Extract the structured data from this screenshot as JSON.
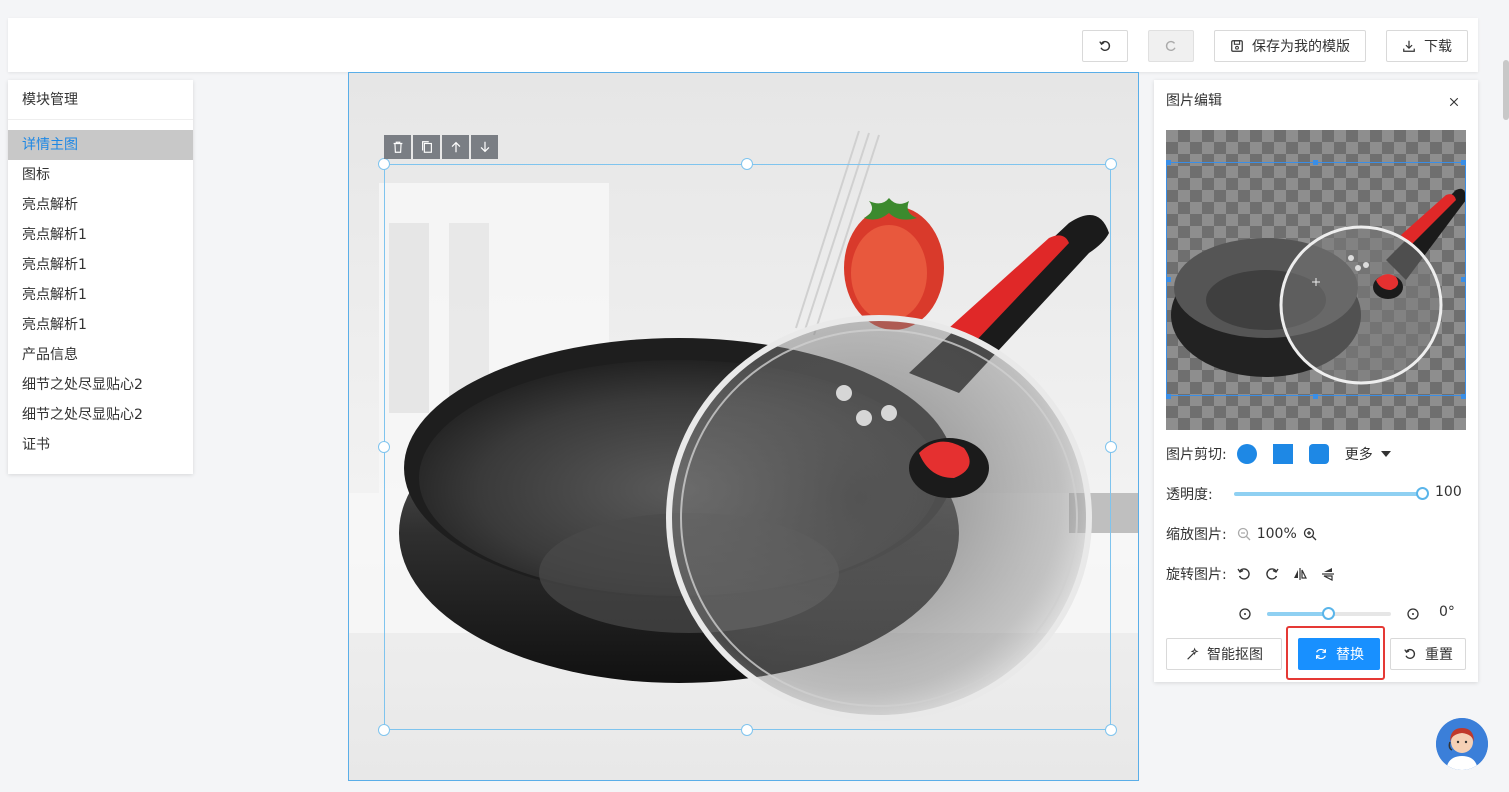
{
  "toolbar": {
    "save_template_label": "保存为我的模版",
    "download_label": "下载"
  },
  "module_panel": {
    "title": "模块管理",
    "items": [
      {
        "label": "详情主图",
        "active": true
      },
      {
        "label": "图标"
      },
      {
        "label": "亮点解析"
      },
      {
        "label": "亮点解析1"
      },
      {
        "label": "亮点解析1"
      },
      {
        "label": "亮点解析1"
      },
      {
        "label": "亮点解析1"
      },
      {
        "label": "产品信息"
      },
      {
        "label": "细节之处尽显贴心2"
      },
      {
        "label": "细节之处尽显贴心2"
      },
      {
        "label": "证书"
      }
    ]
  },
  "image_editor": {
    "title": "图片编辑",
    "crop_label": "图片剪切:",
    "more_label": "更多",
    "opacity_label": "透明度:",
    "opacity_value": "100",
    "zoom_label": "缩放图片:",
    "zoom_value": "100%",
    "rotate_label": "旋转图片:",
    "rotate_value": "0°",
    "smart_cutout_label": "智能抠图",
    "replace_label": "替换",
    "reset_label": "重置"
  },
  "colors": {
    "accent": "#1890ff",
    "active_text": "#1e88e5",
    "highlight": "#e53935",
    "selection": "#7fc4ee"
  },
  "icons": [
    "undo-icon",
    "redo-icon",
    "save-icon",
    "download-icon",
    "trash-icon",
    "copy-icon",
    "arrow-up-icon",
    "arrow-down-icon",
    "close-icon",
    "zoom-out-icon",
    "zoom-in-icon",
    "rotate-left-icon",
    "rotate-right-icon",
    "flip-horizontal-icon",
    "flip-vertical-icon",
    "magic-wand-icon",
    "refresh-icon",
    "reset-icon",
    "customer-service-avatar"
  ]
}
